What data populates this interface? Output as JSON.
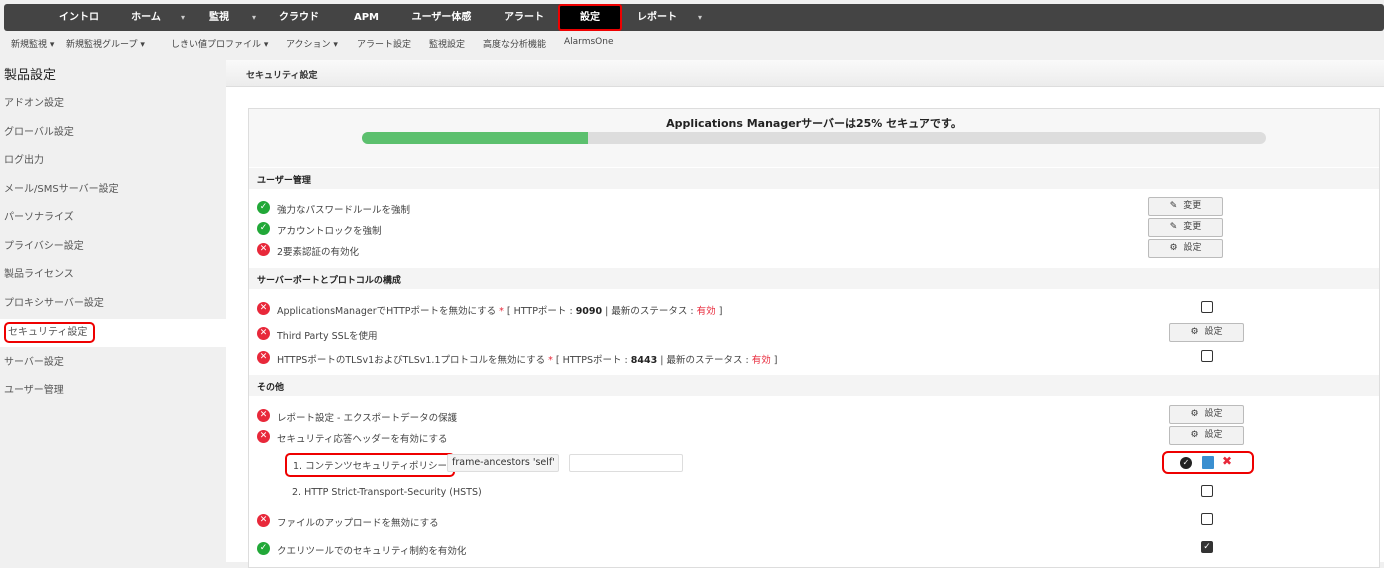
{
  "topnav": {
    "items": [
      "イントロ",
      "ホーム",
      "監視",
      "クラウド",
      "APM",
      "ユーザー体感",
      "アラート",
      "設定",
      "レポート"
    ],
    "active": "設定"
  },
  "subnav": {
    "items": [
      "新規監視 ▾",
      "新規監視グループ ▾",
      "しきい値プロファイル ▾",
      "アクション ▾",
      "アラート設定",
      "監視設定",
      "高度な分析機能",
      "AlarmsOne"
    ]
  },
  "sidebar": {
    "title": "製品設定",
    "items": [
      "アドオン設定",
      "グローバル設定",
      "ログ出力",
      "メール/SMSサーバー設定",
      "パーソナライズ",
      "プライバシー設定",
      "製品ライセンス",
      "プロキシサーバー設定",
      "セキュリティ設定",
      "サーバー設定",
      "ユーザー管理"
    ],
    "active": "セキュリティ設定"
  },
  "main": {
    "header": "セキュリティ設定",
    "security_title": "Applications Managerサーバーは25% セキュアです。",
    "security_percent": 25,
    "sections": {
      "user": "ユーザー管理",
      "server": "サーバーポートとプロトコルの構成",
      "other": "その他"
    },
    "rows": {
      "pw": {
        "label": "強力なパスワードルールを強制",
        "status": "ok",
        "button": "変更"
      },
      "lock": {
        "label": "アカウントロックを強制",
        "status": "ok",
        "button": "変更"
      },
      "tfa": {
        "label": "2要素認証の有効化",
        "status": "ng",
        "button": "設定"
      },
      "http": {
        "label": "ApplicationsManagerでHTTPポートを無効にする",
        "star": "*",
        "port_label": "[ HTTPポート :",
        "port": "9090",
        "sep": "| 最新のステータス :",
        "state": "有効",
        "end": "]",
        "checked": false
      },
      "ssl": {
        "label": "Third Party SSLを使用",
        "status": "ng",
        "button": "設定"
      },
      "tls": {
        "label": "HTTPSポートのTLSv1およびTLSv1.1プロトコルを無効にする",
        "star": "*",
        "port_label": "[ HTTPSポート :",
        "port": "8443",
        "sep": "| 最新のステータス :",
        "state": "有効",
        "end": "]",
        "checked": false
      },
      "report": {
        "label": "レポート設定 - エクスポートデータの保護",
        "status": "ng",
        "button": "設定"
      },
      "headers": {
        "label": "セキュリティ応答ヘッダーを有効にする",
        "status": "ng",
        "button": "設定"
      },
      "csp": {
        "label": "1. コンテンツセキュリティポリシー",
        "value": "frame-ancestors 'self'",
        "extra": ""
      },
      "hsts": {
        "label": "2. HTTP Strict-Transport-Security (HSTS)",
        "checked": false
      },
      "upload": {
        "label": "ファイルのアップロードを無効にする",
        "status": "ng",
        "checked": false
      },
      "query": {
        "label": "クエリツールでのセキュリティ制約を有効化",
        "status": "ok",
        "checked": true
      }
    }
  },
  "colors": {
    "ok": "#22a838",
    "ng": "#e8283a",
    "progress": "#5cc06e",
    "highlight": "#e00000"
  }
}
